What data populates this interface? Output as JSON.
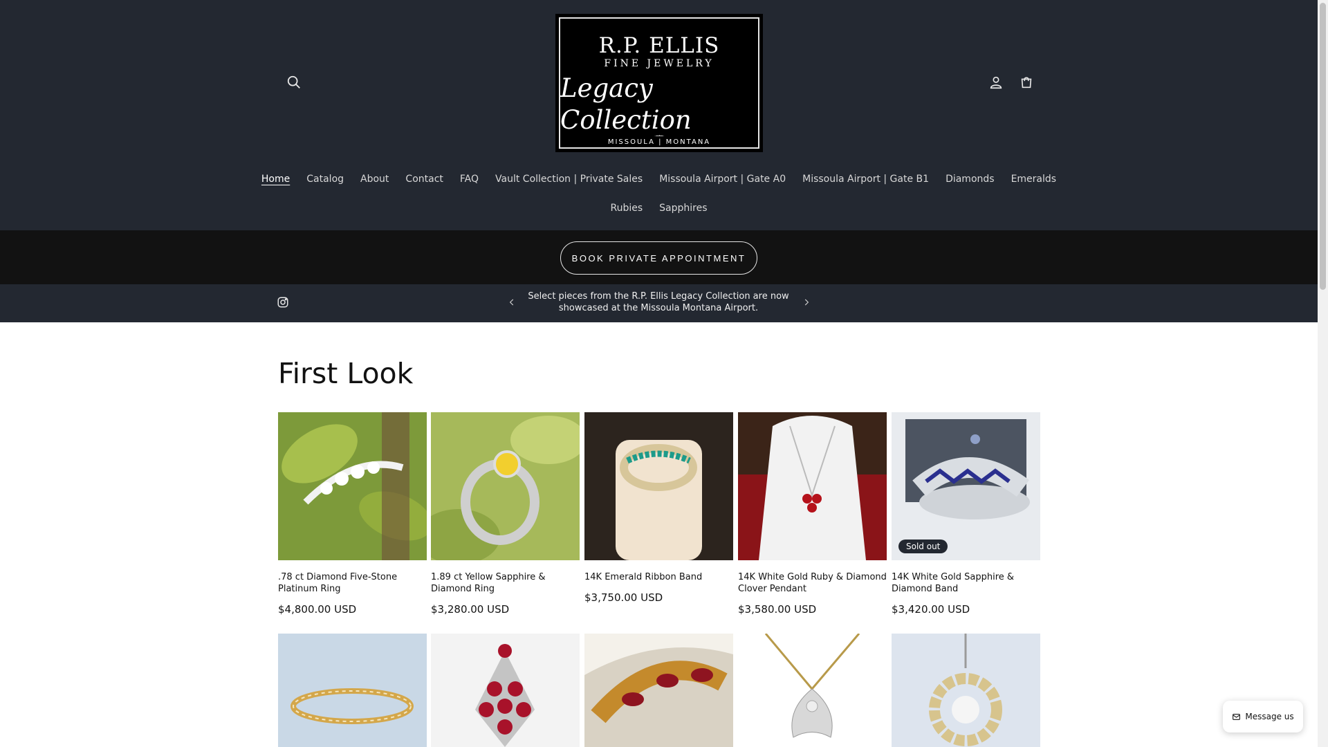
{
  "logo": {
    "brand": "R.P. ELLIS",
    "sub": "FINE JEWELRY",
    "script": "Legacy Collection",
    "place": "MISSOULA | MONTANA"
  },
  "nav": {
    "row1": [
      "Home",
      "Catalog",
      "About",
      "Contact",
      "FAQ",
      "Vault Collection | Private Sales",
      "Missoula Airport | Gate A0",
      "Missoula Airport | Gate B1",
      "Diamonds",
      "Emeralds"
    ],
    "row2": [
      "Rubies",
      "Sapphires"
    ],
    "active": "Home"
  },
  "book_button": "BOOK PRIVATE APPOINTMENT",
  "announcement": "Select pieces from the R.P. Ellis Legacy Collection are now showcased at the Missoula Montana Airport.",
  "section_title": "First Look",
  "products": [
    {
      "title": ".78 ct Diamond Five-Stone Platinum Ring",
      "price": "$4,800.00 USD",
      "badge": "",
      "bg": "#7d9a3a"
    },
    {
      "title": "1.89 ct Yellow Sapphire & Diamond Ring",
      "price": "$3,280.00 USD",
      "badge": "",
      "bg": "#a6b95a"
    },
    {
      "title": "14K Emerald Ribbon Band",
      "price": "$3,750.00 USD",
      "badge": "",
      "bg": "#3a2a20"
    },
    {
      "title": "14K White Gold Ruby & Diamond Clover Pendant",
      "price": "$3,580.00 USD",
      "badge": "",
      "bg": "#8a1418"
    },
    {
      "title": "14K White Gold Sapphire & Diamond Band",
      "price": "$3,420.00 USD",
      "badge": "Sold out",
      "bg": "#5b6370"
    }
  ],
  "products_row2": [
    {
      "bg": "#c9d8e6"
    },
    {
      "bg": "#f3f3f3"
    },
    {
      "bg": "#d9d2c4"
    },
    {
      "bg": "#ffffff"
    },
    {
      "bg": "#dde4ee"
    }
  ],
  "message_button": "Message us",
  "colors": {
    "header_bg": "#232831",
    "book_bar_bg": "#121212"
  }
}
